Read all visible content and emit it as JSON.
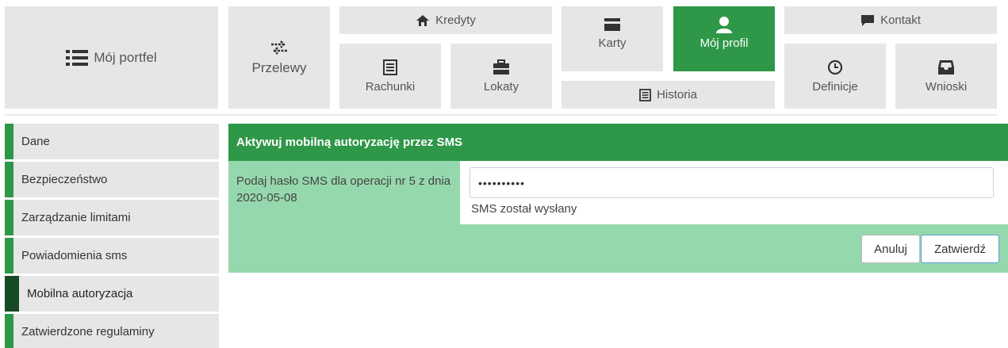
{
  "nav": {
    "portfolio": {
      "label": "Mój portfel",
      "icon": "list-icon"
    },
    "transfers": {
      "label": "Przelewy",
      "icon": "transfer-arrows-icon"
    },
    "credits": {
      "label": "Kredyty",
      "icon": "home-icon"
    },
    "accounts": {
      "label": "Rachunki",
      "icon": "ledger-icon"
    },
    "deposits": {
      "label": "Lokaty",
      "icon": "briefcase-icon"
    },
    "cards": {
      "label": "Karty",
      "icon": "card-icon"
    },
    "profile": {
      "label": "Mój profil",
      "icon": "user-icon"
    },
    "history": {
      "label": "Historia",
      "icon": "ledger-icon"
    },
    "contact": {
      "label": "Kontakt",
      "icon": "chat-bubble-icon"
    },
    "definitions": {
      "label": "Definicje",
      "icon": "clock-icon"
    },
    "applications": {
      "label": "Wnioski",
      "icon": "inbox-icon"
    }
  },
  "sidebar": {
    "items": [
      {
        "label": "Dane"
      },
      {
        "label": "Bezpieczeństwo"
      },
      {
        "label": "Zarządzanie limitami"
      },
      {
        "label": "Powiadomienia sms"
      },
      {
        "label": "Mobilna autoryzacja"
      },
      {
        "label": "Zatwierdzone regulaminy"
      }
    ],
    "active_index": 4
  },
  "panel": {
    "title": "Aktywuj mobilną autoryzację przez SMS",
    "prompt": "Podaj hasło SMS dla operacji nr 5 z dnia 2020-05-08",
    "sms_input_value": "••••••••••",
    "status": "SMS został wysłany",
    "cancel_label": "Anuluj",
    "confirm_label": "Zatwierdź"
  },
  "colors": {
    "brand_green": "#2e9748",
    "panel_green": "#96d8ad",
    "active_sidebar_marker": "#164a25",
    "tile_gray": "#e6e6e6",
    "primary_button_border": "#5a9fd8"
  }
}
